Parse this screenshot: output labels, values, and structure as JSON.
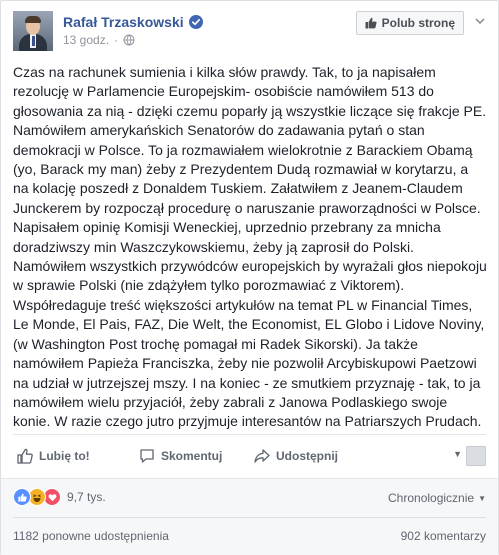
{
  "post": {
    "author": "Rafał Trzaskowski",
    "time": "13 godz.",
    "separator": "·",
    "like_page_label": "Polub stronę",
    "text": "Czas na rachunek sumienia i kilka słów prawdy. Tak, to ja napisałem rezolucję w Parlamencie Europejskim- osobiście namówiłem 513 do głosowania za nią - dzięki czemu poparły ją wszystkie liczące się frakcje PE. Namówiłem amerykańskich Senatorów do zadawania pytań o stan demokracji w Polsce. To ja rozmawiałem wielokrotnie z Barackiem Obamą (yo, Barack my man) żeby z Prezydentem Dudą rozmawiał w korytarzu, a na kolację poszedł z Donaldem Tuskiem. Załatwiłem z Jeanem-Claudem Junckerem by rozpoczął procedurę o naruszanie praworządności w Polsce. Napisałem opinię Komisji Weneckiej, uprzednio przebrany za mnicha doradziwszy min Waszczykowskiemu, żeby ją zaprosił do Polski. Namówiłem wszystkich przywódców europejskich by wyrażali głos niepokoju w sprawie Polski (nie zdążyłem tylko porozmawiać z Viktorem). Współredaguje treść większości artykułów na temat PL w Financial Times, Le Monde, El Pais, FAZ, Die Welt, the Economist, EL Globo i Lidove Noviny, (w Washington Post trochę pomagał mi Radek Sikorski). Ja także namówiłem Papieża Franciszka, żeby nie pozwolił Arcybiskupowi Paetzowi na udział w jutrzejszej mszy. I na koniec - ze smutkiem przyznaję - tak, to ja namówiłem wielu przyjaciół, żeby zabrali z Janowa Podlaskiego swoje konie. W razie czego jutro przyjmuje interesantów na Patriarszych Prudach."
  },
  "actions": {
    "like": "Lubię to!",
    "comment": "Skomentuj",
    "share": "Udostępnij"
  },
  "footer": {
    "reactions_count": "9,7 tys.",
    "order_label": "Chronologicznie",
    "shares": "1182 ponowne udostępnienia",
    "comments": "902 komentarzy"
  },
  "colors": {
    "link_blue": "#365899",
    "like_blue": "#5890ff",
    "haha_yellow": "#f7b125",
    "love_red": "#f25268"
  },
  "icons": [
    "verified-badge-icon",
    "globe-icon",
    "thumbs-up-icon",
    "comment-icon",
    "share-icon",
    "chevron-down-icon",
    "like-reaction-icon",
    "haha-reaction-icon",
    "love-reaction-icon"
  ]
}
